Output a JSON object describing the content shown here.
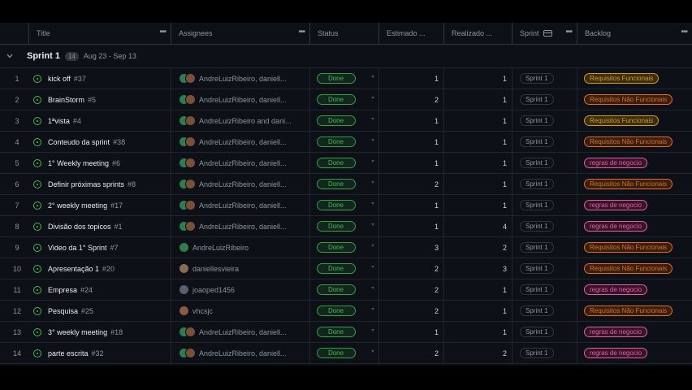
{
  "columns": {
    "title": "Title",
    "assignees": "Assignees",
    "status": "Status",
    "estimated": "Estimado ...",
    "realized": "Realizado ...",
    "sprint": "Sprint",
    "backlog": "Backlog",
    "menu_glyph": "•••"
  },
  "group": {
    "title": "Sprint 1",
    "count": "14",
    "dates": "Aug 23 - Sep 13"
  },
  "colors": {
    "done": "#3fb950",
    "funcionais": "#d29922",
    "nao_funcionais": "#db6d28",
    "negocio": "#db61a2"
  },
  "rows": [
    {
      "n": "1",
      "title": "kick off",
      "num": "#37",
      "assignees": "AndreLuizRibeiro, daniell...",
      "avatars": [
        "#2f7d4f",
        "#7a4f3a"
      ],
      "status": "Done",
      "est": "1",
      "real": "1",
      "sprint": "Sprint 1",
      "backlog": "Requisitos Funcionais",
      "btype": "funcionais"
    },
    {
      "n": "2",
      "title": "BrainStorm",
      "num": "#5",
      "assignees": "AndreLuizRibeiro, daniell...",
      "avatars": [
        "#2f7d4f",
        "#7a4f3a"
      ],
      "status": "Done",
      "est": "2",
      "real": "1",
      "sprint": "Sprint 1",
      "backlog": "Requisitos Não Funcionais",
      "btype": "nao_funcionais"
    },
    {
      "n": "3",
      "title": "1ªvista",
      "num": "#4",
      "assignees": "AndreLuizRibeiro and dani...",
      "avatars": [
        "#2f7d4f",
        "#7a4f3a"
      ],
      "status": "Done",
      "est": "1",
      "real": "1",
      "sprint": "Sprint 1",
      "backlog": "Requisitos Funcionais",
      "btype": "funcionais"
    },
    {
      "n": "4",
      "title": "Conteudo da sprint",
      "num": "#38",
      "assignees": "AndreLuizRibeiro, daniell...",
      "avatars": [
        "#2f7d4f",
        "#7a4f3a"
      ],
      "status": "Done",
      "est": "1",
      "real": "1",
      "sprint": "Sprint 1",
      "backlog": "Requisitos Não Funcionais",
      "btype": "nao_funcionais"
    },
    {
      "n": "5",
      "title": "1° Weekly meeting",
      "num": "#6",
      "assignees": "AndreLuizRibeiro, daniell...",
      "avatars": [
        "#2f7d4f",
        "#7a4f3a"
      ],
      "status": "Done",
      "est": "1",
      "real": "1",
      "sprint": "Sprint 1",
      "backlog": "regras de negocio",
      "btype": "negocio"
    },
    {
      "n": "6",
      "title": "Definir próximas sprints",
      "num": "#8",
      "assignees": "AndreLuizRibeiro, daniell...",
      "avatars": [
        "#2f7d4f",
        "#7a4f3a"
      ],
      "status": "Done",
      "est": "2",
      "real": "1",
      "sprint": "Sprint 1",
      "backlog": "Requisitos Não Funcionais",
      "btype": "nao_funcionais"
    },
    {
      "n": "7",
      "title": "2° weekly meeting",
      "num": "#17",
      "assignees": "AndreLuizRibeiro, daniell...",
      "avatars": [
        "#2f7d4f",
        "#7a4f3a"
      ],
      "status": "Done",
      "est": "1",
      "real": "1",
      "sprint": "Sprint 1",
      "backlog": "regras de negocio",
      "btype": "negocio"
    },
    {
      "n": "8",
      "title": "Divisão dos topicos",
      "num": "#1",
      "assignees": "AndreLuizRibeiro, daniell...",
      "avatars": [
        "#2f7d4f",
        "#7a4f3a"
      ],
      "status": "Done",
      "est": "1",
      "real": "4",
      "sprint": "Sprint 1",
      "backlog": "regras de negocio",
      "btype": "negocio"
    },
    {
      "n": "9",
      "title": "Video da 1° Sprint",
      "num": "#7",
      "assignees": "AndreLuizRibeiro",
      "avatars": [
        "#2f7d4f"
      ],
      "status": "Done",
      "est": "3",
      "real": "2",
      "sprint": "Sprint 1",
      "backlog": "Requisitos Não Funcionais",
      "btype": "nao_funcionais"
    },
    {
      "n": "10",
      "title": "Apresentação 1",
      "num": "#20",
      "assignees": "daniellesvieira",
      "avatars": [
        "#8a6a55"
      ],
      "status": "Done",
      "est": "2",
      "real": "3",
      "sprint": "Sprint 1",
      "backlog": "Requisitos Não Funcionais",
      "btype": "nao_funcionais"
    },
    {
      "n": "11",
      "title": "Empresa",
      "num": "#24",
      "assignees": "joaoped1456",
      "avatars": [
        "#5a5f6e"
      ],
      "status": "Done",
      "est": "2",
      "real": "1",
      "sprint": "Sprint 1",
      "backlog": "regras de negocio",
      "btype": "negocio"
    },
    {
      "n": "12",
      "title": "Pesquisa",
      "num": "#25",
      "assignees": "vhcsjc",
      "avatars": [
        "#8a5a48"
      ],
      "status": "Done",
      "est": "2",
      "real": "1",
      "sprint": "Sprint 1",
      "backlog": "Requisitos Não Funcionais",
      "btype": "nao_funcionais"
    },
    {
      "n": "13",
      "title": "3° weekly meeting",
      "num": "#18",
      "assignees": "AndreLuizRibeiro, daniell...",
      "avatars": [
        "#2f7d4f",
        "#7a4f3a"
      ],
      "status": "Done",
      "est": "1",
      "real": "1",
      "sprint": "Sprint 1",
      "backlog": "regras de negocio",
      "btype": "negocio"
    },
    {
      "n": "14",
      "title": "parte escrita",
      "num": "#32",
      "assignees": "AndreLuizRibeiro, daniell...",
      "avatars": [
        "#2f7d4f",
        "#7a4f3a"
      ],
      "status": "Done",
      "est": "2",
      "real": "2",
      "sprint": "Sprint 1",
      "backlog": "regras de negocio",
      "btype": "negocio"
    }
  ]
}
